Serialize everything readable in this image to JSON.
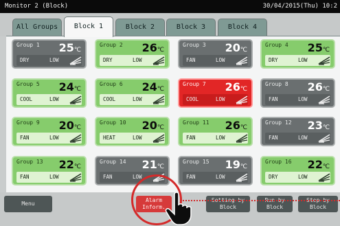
{
  "titlebar": {
    "left": "Monitor 2 (Block)",
    "right": "30/04/2015(Thu) 10:2"
  },
  "tabs": [
    "All Groups",
    "Block 1",
    "Block 2",
    "Block 3",
    "Block 4"
  ],
  "groups": [
    {
      "name": "Group 1",
      "temp": "25",
      "unit": "℃",
      "mode": "DRY",
      "fan": "LOW",
      "state": "off"
    },
    {
      "name": "Group 2",
      "temp": "26",
      "unit": "℃",
      "mode": "DRY",
      "fan": "LOW",
      "state": "on"
    },
    {
      "name": "Group 3",
      "temp": "20",
      "unit": "℃",
      "mode": "FAN",
      "fan": "LOW",
      "state": "off"
    },
    {
      "name": "Group 4",
      "temp": "25",
      "unit": "℃",
      "mode": "DRY",
      "fan": "LOW",
      "state": "on"
    },
    {
      "name": "Group 5",
      "temp": "24",
      "unit": "℃",
      "mode": "COOL",
      "fan": "LOW",
      "state": "on"
    },
    {
      "name": "Group 6",
      "temp": "24",
      "unit": "℃",
      "mode": "COOL",
      "fan": "LOW",
      "state": "on"
    },
    {
      "name": "Group 7",
      "temp": "26",
      "unit": "℃",
      "mode": "COOL",
      "fan": "LOW",
      "state": "alarm"
    },
    {
      "name": "Group 8",
      "temp": "26",
      "unit": "℃",
      "mode": "FAN",
      "fan": "LOW",
      "state": "off"
    },
    {
      "name": "Group 9",
      "temp": "20",
      "unit": "℃",
      "mode": "FAN",
      "fan": "LOW",
      "state": "on"
    },
    {
      "name": "Group 10",
      "temp": "20",
      "unit": "℃",
      "mode": "HEAT",
      "fan": "LOW",
      "state": "on"
    },
    {
      "name": "Group 11",
      "temp": "26",
      "unit": "℃",
      "mode": "FAN",
      "fan": "LOW",
      "state": "on"
    },
    {
      "name": "Group 12",
      "temp": "23",
      "unit": "℃",
      "mode": "FAN",
      "fan": "LOW",
      "state": "off"
    },
    {
      "name": "Group 13",
      "temp": "22",
      "unit": "℃",
      "mode": "FAN",
      "fan": "LOW",
      "state": "on"
    },
    {
      "name": "Group 14",
      "temp": "21",
      "unit": "℃",
      "mode": "FAN",
      "fan": "LOW",
      "state": "off"
    },
    {
      "name": "Group 15",
      "temp": "19",
      "unit": "℃",
      "mode": "FAN",
      "fan": "LOW",
      "state": "off"
    },
    {
      "name": "Group 16",
      "temp": "22",
      "unit": "℃",
      "mode": "DRY",
      "fan": "LOW",
      "state": "on"
    }
  ],
  "buttons": {
    "menu": "Menu",
    "alarm_line1": "Alarm",
    "alarm_line2": "Inform.",
    "setting_line1": "Setting by",
    "setting_line2": "Block",
    "runby_line1": "Run by",
    "runby_line2": "Block",
    "stopby_line1": "Stop by",
    "stopby_line2": "Block"
  },
  "colors": {
    "on": "#86cc6c",
    "off": "#6a6f70",
    "alarm": "#e22626",
    "highlight": "#d42a2a"
  },
  "icons": {
    "louver": "louver-swing-icon",
    "pointer": "hand-pointer-icon"
  }
}
